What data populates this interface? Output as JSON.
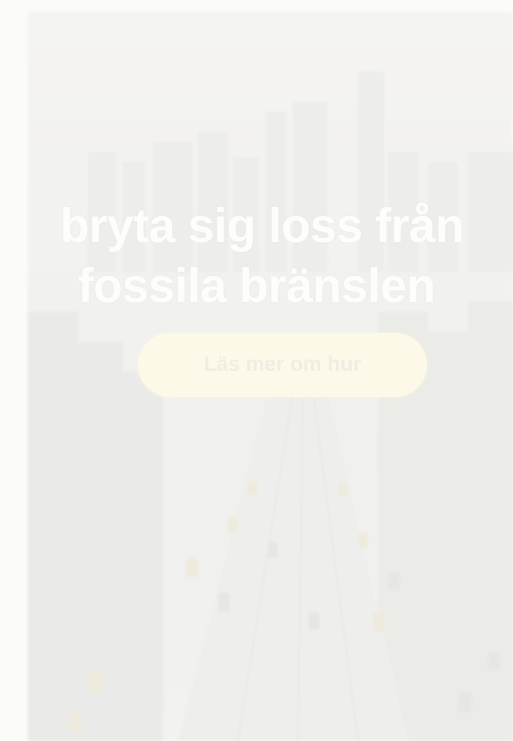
{
  "hero": {
    "headline_line_1": "bryta sig loss från",
    "headline_line_2": "fossila bränslen",
    "cta_label": "Läs mer om hur",
    "image_name": "city-skyline-highway-image"
  },
  "colors": {
    "background": "#fbfbfa",
    "headline_text": "#fdfdfc",
    "cta_background": "#fcf9e8",
    "cta_text": "#efeee2"
  }
}
